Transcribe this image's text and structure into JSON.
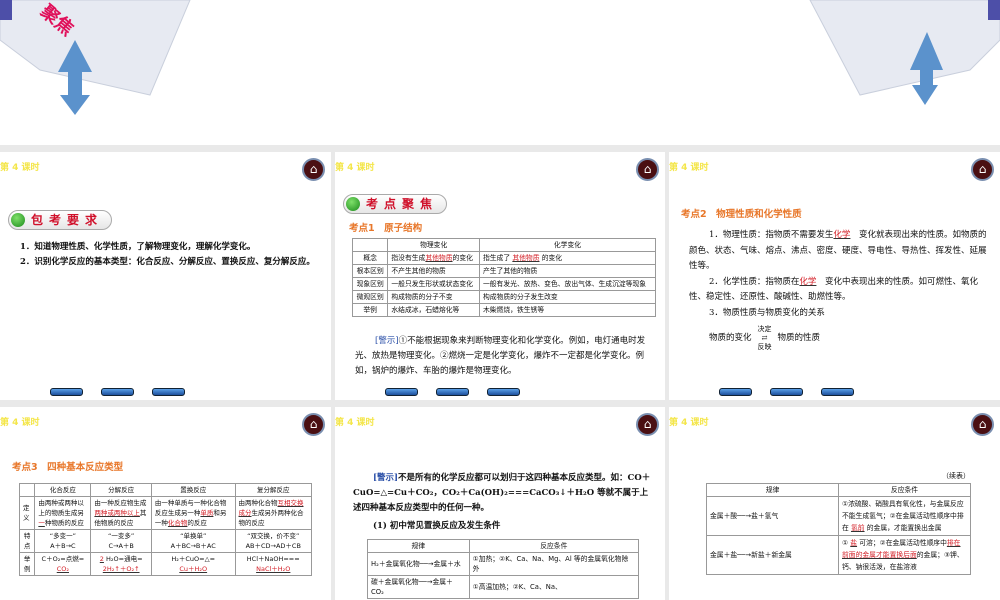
{
  "lesson_label": "第 4 课时",
  "top_slide": {
    "banner_text": "聚焦"
  },
  "s1": {
    "pill": "包考要求",
    "items": [
      "1．知道物理性质、化学性质，了解物理变化，理解化学变化。",
      "2．识别化学反应的基本类型：化合反应、分解反应、置换反应、复分解反应。"
    ]
  },
  "s2": {
    "pill": "考点聚焦",
    "heading": "考点1　原子结构",
    "headers": [
      "",
      "物理变化",
      "化学变化"
    ],
    "rows": [
      {
        "k": "概念",
        "a_pre": "指没有生成",
        "a_fill": "其他物质",
        "a_post": "的变化",
        "b_pre": "指生成了",
        "b_fill": "其他物质",
        "b_post": "的变化"
      },
      {
        "k": "根本区别",
        "a": "不产生其他的物质",
        "b": "产生了其他的物质"
      },
      {
        "k": "现象区别",
        "a": "一般只发生形状或状态变化",
        "b": "一般有发光、放热、变色、放出气体、生成沉淀等现象"
      },
      {
        "k": "微观区别",
        "a": "构成物质的分子不变",
        "b": "构成物质的分子发生改变"
      },
      {
        "k": "举例",
        "a": "水结成冰，石蜡熔化等",
        "b": "木柴燃烧，铁生锈等"
      }
    ],
    "warn_label": "[警示]",
    "warn": "①不能根据现象来判断物理变化和化学变化。例如，电灯通电时发光、放热是物理变化。②燃烧一定是化学变化，爆炸不一定都是化学变化。例如，锅炉的爆炸、车胎的爆炸是物理变化。"
  },
  "s3": {
    "heading": "考点2　物理性质和化学性质",
    "p1_pre": "1．物理性质：指物质不需要发生",
    "p1_fill": "化学",
    "p1_post": "变化就表现出来的性质。如物质的颜色、状态、气味、熔点、沸点、密度、硬度、导电性、导热性、挥发性、延展性等。",
    "p2_pre": "2．化学性质：指物质在",
    "p2_fill": "化学",
    "p2_post": "变化中表现出来的性质。如可燃性、氧化性、稳定性、还原性、酸碱性、助燃性等。",
    "p3": "3．物质性质与物质变化的关系",
    "rel_left": "物质的变化",
    "rel_top": "决定",
    "rel_bottom": "反映",
    "rel_right": "物质的性质"
  },
  "s4": {
    "heading": "考点3　四种基本反应类型",
    "headers": [
      "",
      "化合反应",
      "分解反应",
      "置换反应",
      "复分解反应"
    ],
    "def_label": "定义",
    "def": [
      "由两种或两种以上的物质生成另",
      "一",
      "种物质的反应",
      "由一种反应物生成",
      "两种或两种以上",
      "其他物质的反应",
      "由一种单质与一种化合物反应生成另一种",
      "单质",
      "和另一种",
      "化合物",
      "的反应",
      "由两种化合物",
      "互相交换成分",
      "生成另外两种化合物的反应"
    ],
    "feat_label": "特点",
    "feat": [
      "“多变一”",
      "A＋B→C",
      "“一变多”",
      "C→A＋B",
      "“单换单”",
      "A＋BC→B＋AC",
      "“双交换，价不变”",
      "AB＋CD→AD＋CB"
    ],
    "ex_label": "举例",
    "ex": [
      "C＋O₂=点燃=",
      "CO₂",
      "2",
      "H₂O=通电=",
      "2H₂↑＋O₂↑",
      "H₂＋CuO=△=",
      "Cu＋H₂O",
      "HCl＋NaOH===",
      "NaCl＋H₂O"
    ]
  },
  "s5": {
    "warn_label": "[警示]",
    "warn": "不是所有的化学反应都可以划归于这四种基本反应类型。如：CO＋CuO=△=Cu＋CO₂，CO₂＋Ca(OH)₂===CaCO₃↓＋H₂O 等就不属于上述四种基本反应类型中的任何一种。",
    "sub": "(1) 初中常见置换反应及发生条件",
    "headers": [
      "规律",
      "反应条件"
    ],
    "rows": [
      [
        "H₂＋金属氧化物──→金属＋水",
        "①加热；②K、Ca、Na、Mg、Al 等的金属氧化物除外"
      ],
      [
        "碳＋金属氧化物──→金属＋CO₂",
        "①高温加热；②K、Ca、Na、"
      ]
    ]
  },
  "s6": {
    "cont": "（续表）",
    "headers": [
      "规律",
      "反应条件"
    ],
    "r1": {
      "k": "金属＋酸──→盐＋氢气",
      "pre": "①浓硫酸、硝酸具有氧化性，与金属反应不能生成氢气；②在金属活动性顺序中排在",
      "fill": "氢前",
      "post": "的金属，才能置换出金属"
    },
    "r2": {
      "k": "金属＋盐──→新盐＋新金属",
      "a": "①",
      "f1": "盐",
      "b": "可溶；②在金属活动性顺序中",
      "f2": "排在前面的金属才能置换后面",
      "c": "的金属；③钾、钙、钠很活泼，在盐溶液"
    }
  }
}
